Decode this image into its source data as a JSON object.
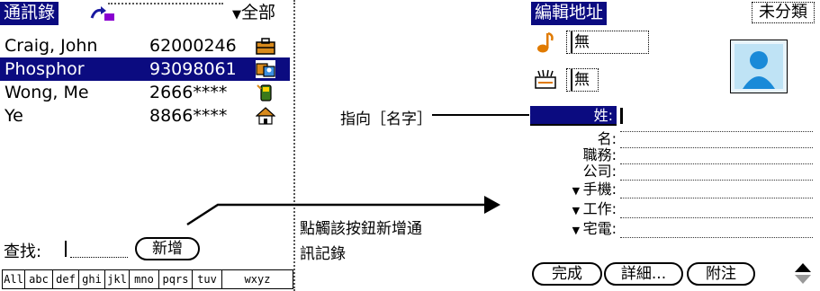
{
  "left": {
    "title": "通訊錄",
    "category": "全部",
    "contacts": [
      {
        "name": "Craig, John",
        "number": "62000246",
        "icon": "briefcase-icon"
      },
      {
        "name": "Phosphor",
        "number": "93098061",
        "icon": "business-card-icon"
      },
      {
        "name": "Wong, Me",
        "number": "2666****",
        "icon": "mobile-phone-icon"
      },
      {
        "name": "Ye",
        "number": "8866****",
        "icon": "home-icon"
      }
    ],
    "find_label": "查找:",
    "new_button": "新增",
    "index_tabs": [
      "All",
      "abc",
      "def",
      "ghi",
      "jkl",
      "mno",
      "pqrs",
      "tuv",
      "wxyz"
    ]
  },
  "right": {
    "title": "編輯地址",
    "category": "未分類",
    "ringtone_value": "無",
    "sms_value": "無",
    "fields": [
      "姓:",
      "名:",
      "職務:",
      "公司:",
      "手機:",
      "工作:",
      "宅電:"
    ],
    "buttons": {
      "done": "完成",
      "details": "詳細...",
      "note": "附注"
    }
  },
  "annotations": {
    "name_pointer": "指向［名字］",
    "new_hint_line1": "點觸該按鈕新增通",
    "new_hint_line2": "訊記錄"
  },
  "colors": {
    "selection": "#0b0b80",
    "accent_orange": "#e07a00"
  }
}
